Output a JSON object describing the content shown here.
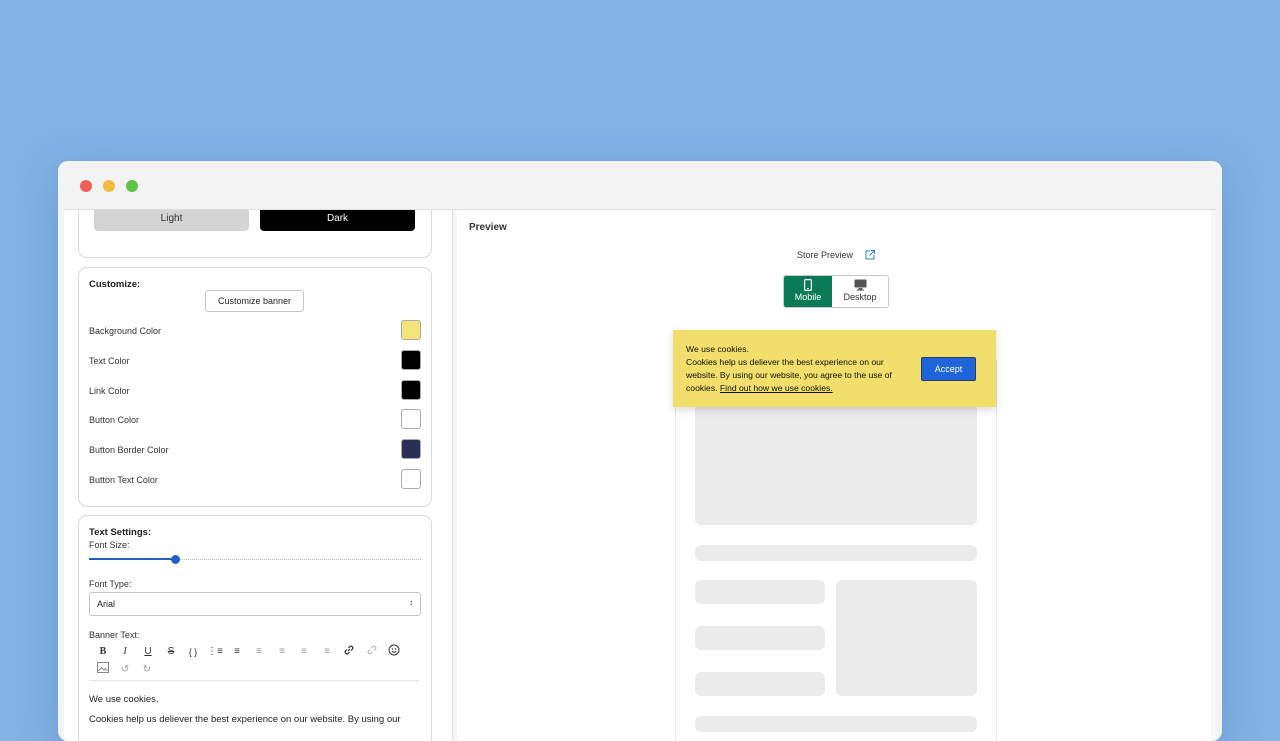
{
  "theme": {
    "light_label": "Light",
    "dark_label": "Dark",
    "selected": "Dark"
  },
  "customize": {
    "title": "Customize:",
    "button_label": "Customize banner",
    "colors": [
      {
        "label": "Background Color",
        "value": "#f3e57a"
      },
      {
        "label": "Text Color",
        "value": "#000000"
      },
      {
        "label": "Link Color",
        "value": "#000000"
      },
      {
        "label": "Button Color",
        "value": "#ffffff"
      },
      {
        "label": "Button Border Color",
        "value": "#2b2f57"
      },
      {
        "label": "Button Text Color",
        "value": "#ffffff"
      }
    ]
  },
  "text_settings": {
    "title": "Text Settings:",
    "font_size_label": "Font Size:",
    "font_size_fraction": 0.26,
    "font_type_label": "Font Type:",
    "font_type_value": "Arial",
    "banner_text_label": "Banner Text:",
    "toolbar_icons": [
      "bold-icon",
      "italic-icon",
      "underline-icon",
      "strikethrough-icon",
      "code-icon",
      "bullet-list-icon",
      "numbered-list-icon",
      "align-left-icon",
      "align-center-icon",
      "align-right-icon",
      "align-justify-icon",
      "link-icon",
      "unlink-icon",
      "emoji-icon",
      "image-icon",
      "undo-icon",
      "redo-icon"
    ],
    "editor_line1": "We use cookies.",
    "editor_line2": "Cookies help us deliever the best experience on our website. By using our"
  },
  "preview": {
    "title": "Preview",
    "store_preview_label": "Store Preview",
    "mobile_label": "Mobile",
    "desktop_label": "Desktop",
    "selected_device": "Mobile",
    "banner": {
      "line1": "We use cookies.",
      "line2": "Cookies help us deliever the best experience on our",
      "line3": "website. By using our website, you agree to the use of",
      "line4_prefix": "cookies.",
      "link_text": "Find out how we use cookies.",
      "accept_label": "Accept"
    }
  }
}
